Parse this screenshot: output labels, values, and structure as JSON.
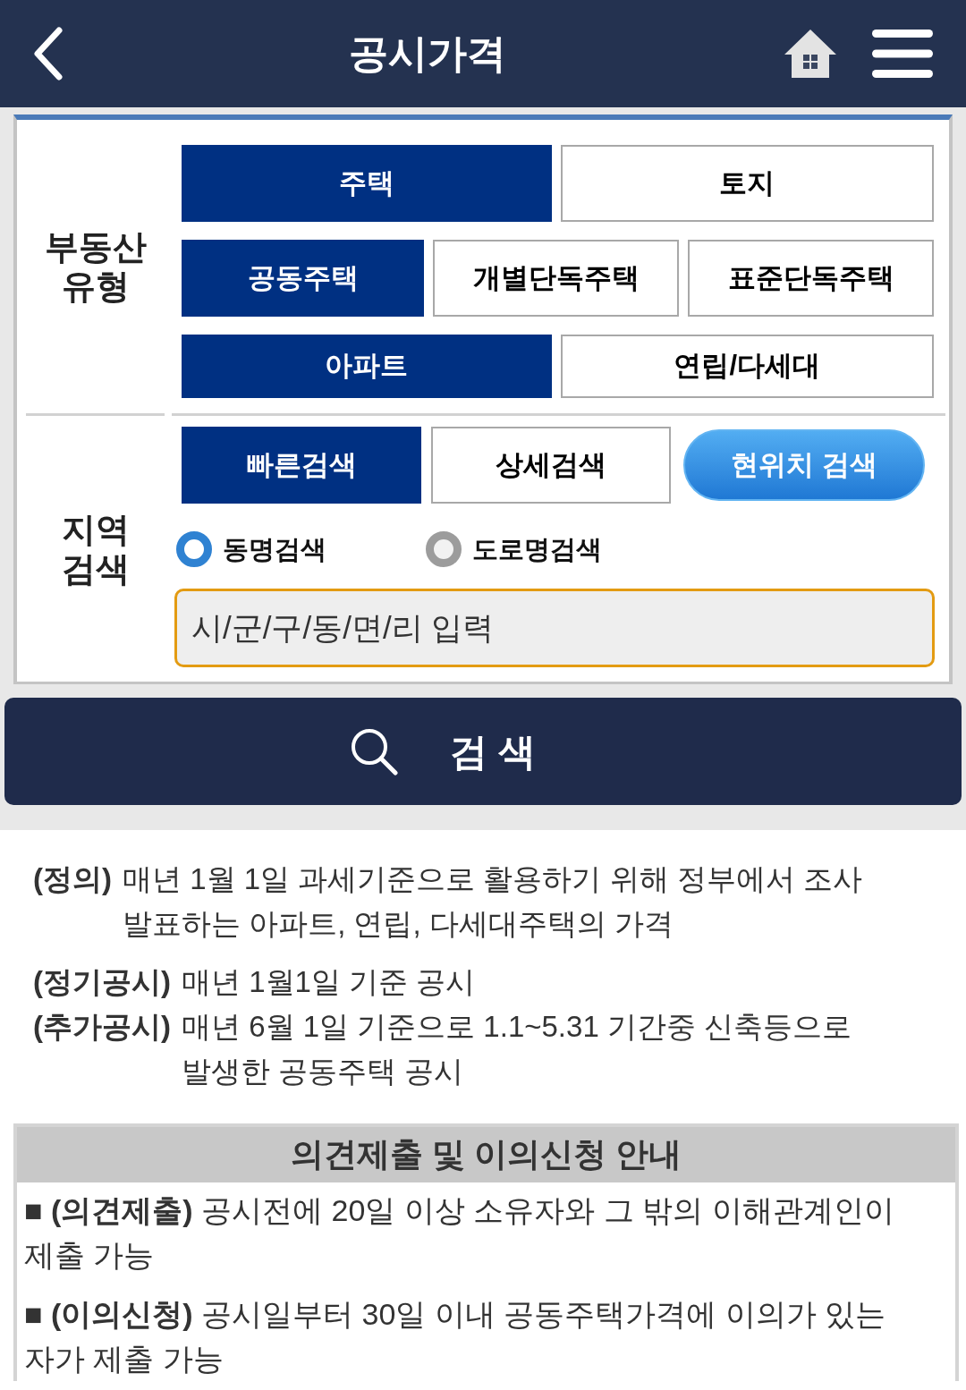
{
  "header": {
    "title": "공시가격"
  },
  "property_type": {
    "label": "부동산 유형",
    "rows": [
      {
        "options": [
          {
            "label": "주택",
            "selected": true
          },
          {
            "label": "토지",
            "selected": false
          }
        ]
      },
      {
        "options": [
          {
            "label": "공동주택",
            "selected": true
          },
          {
            "label": "개별단독주택",
            "selected": false
          },
          {
            "label": "표준단독주택",
            "selected": false
          }
        ]
      },
      {
        "options": [
          {
            "label": "아파트",
            "selected": true
          },
          {
            "label": "연립/다세대",
            "selected": false
          }
        ]
      }
    ]
  },
  "region_search": {
    "label": "지역 검색",
    "modes": [
      {
        "kind": "tab",
        "label": "빠른검색",
        "selected": true
      },
      {
        "kind": "tab",
        "label": "상세검색",
        "selected": false
      },
      {
        "kind": "location",
        "label": "현위치 검색"
      }
    ],
    "radios": [
      {
        "label": "동명검색",
        "selected": true
      },
      {
        "label": "도로명검색",
        "selected": false
      }
    ],
    "search_field": {
      "placeholder": "시/군/구/동/면/리 입력"
    }
  },
  "search_button": {
    "label": "검 색"
  },
  "definitions": [
    {
      "term": "(정의)",
      "text": "매년 1월 1일 과세기준으로 활용하기 위해 정부에서 조사 발표하는 아파트, 연립, 다세대주택의 가격"
    },
    {
      "term": "(정기공시)",
      "text": "매년 1월1일 기준 공시"
    },
    {
      "term": "(추가공시)",
      "text": "매년 6월 1일 기준으로 1.1~5.31 기간중 신축등으로 발생한 공동주택 공시"
    }
  ],
  "notice": {
    "title": "의견제출 및 이의신청 안내",
    "items": [
      "■ **(의견제출)** 공시전에 20일 이상 소유자와 그 밖의 이해관계인이 제출 가능",
      "■ **(이의신청)** 공시일부터 30일 이내 공동주택가격에 이의가 있는 자가 제출 가능"
    ]
  }
}
